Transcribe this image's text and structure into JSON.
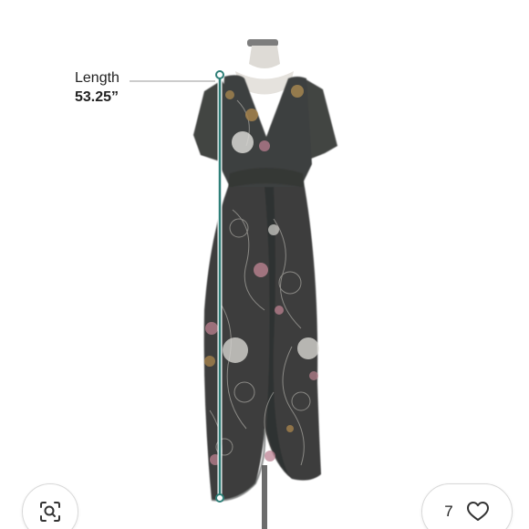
{
  "measurement": {
    "label": "Length",
    "value": "53.25”"
  },
  "actions": {
    "visual_search_icon": "camera-search-icon",
    "like_count": "7",
    "like_icon": "heart-outline-icon"
  },
  "colors": {
    "measure_line": "#2f7f78",
    "dress_base": "#3b3d3c"
  }
}
